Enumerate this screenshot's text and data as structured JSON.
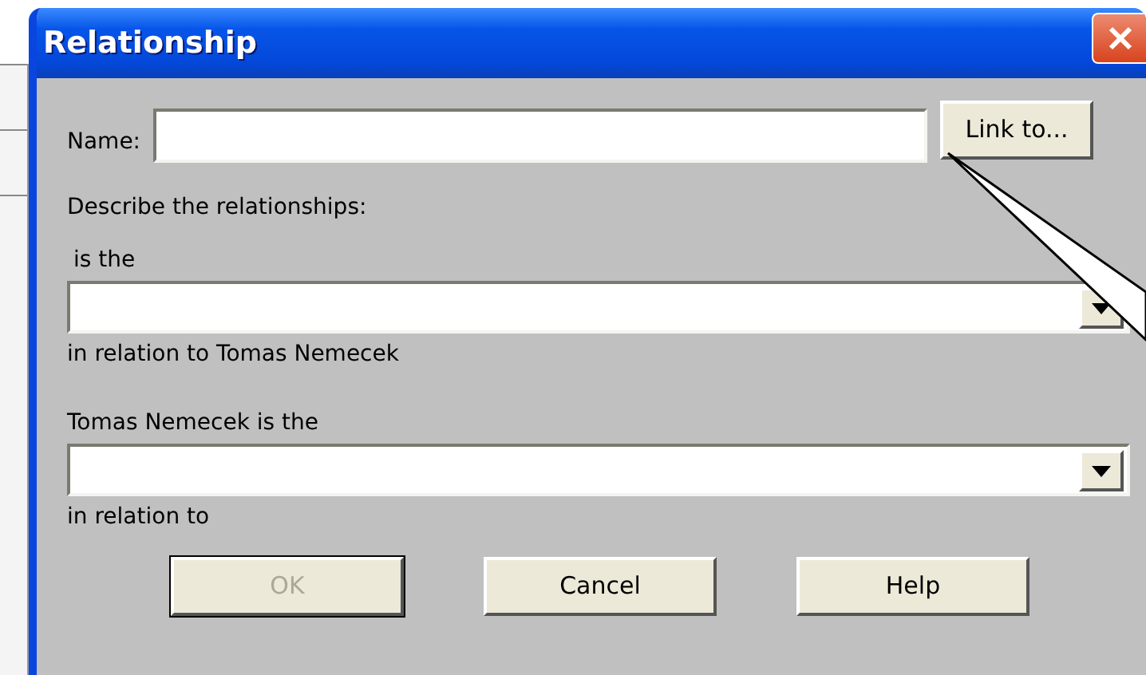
{
  "window": {
    "title": "Relationship"
  },
  "name_field": {
    "label": "Name:"
  },
  "link_button": {
    "label": "Link to..."
  },
  "describe_label": "Describe the relationships:",
  "relations": [
    {
      "before": "is the",
      "after": "in relation to Tomas Nemecek"
    },
    {
      "before": "Tomas Nemecek is the",
      "after": "in relation to"
    }
  ],
  "buttons": [
    {
      "label": "OK",
      "disabled": true,
      "default": true
    },
    {
      "label": "Cancel",
      "disabled": false,
      "default": false
    },
    {
      "label": "Help",
      "disabled": false,
      "default": false
    }
  ]
}
